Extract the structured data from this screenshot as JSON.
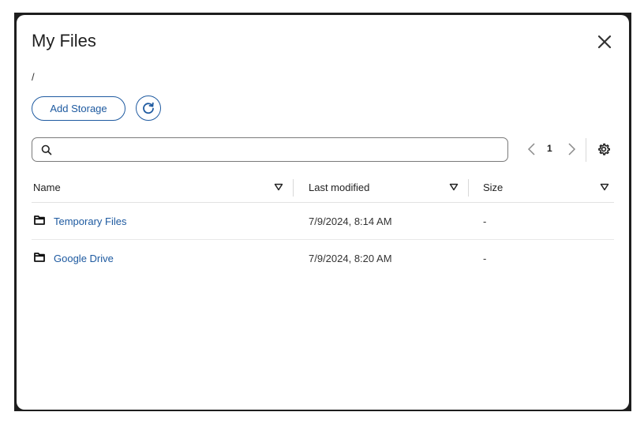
{
  "dialog": {
    "title": "My Files",
    "breadcrumb": "/"
  },
  "toolbar": {
    "add_storage_label": "Add Storage",
    "search_placeholder": "",
    "page_number": "1"
  },
  "table": {
    "columns": [
      "Name",
      "Last modified",
      "Size"
    ],
    "rows": [
      {
        "name": "Temporary Files",
        "modified": "7/9/2024, 8:14 AM",
        "size": "-"
      },
      {
        "name": "Google Drive",
        "modified": "7/9/2024, 8:20 AM",
        "size": "-"
      }
    ]
  },
  "icons": {
    "close": "close-icon",
    "refresh": "refresh-icon",
    "search": "search-icon",
    "settings": "gear-icon",
    "folder": "folder-icon",
    "sort": "sort-down-icon"
  },
  "colors": {
    "accent": "#1e5aa0",
    "backdrop": "#1e1e1e"
  }
}
